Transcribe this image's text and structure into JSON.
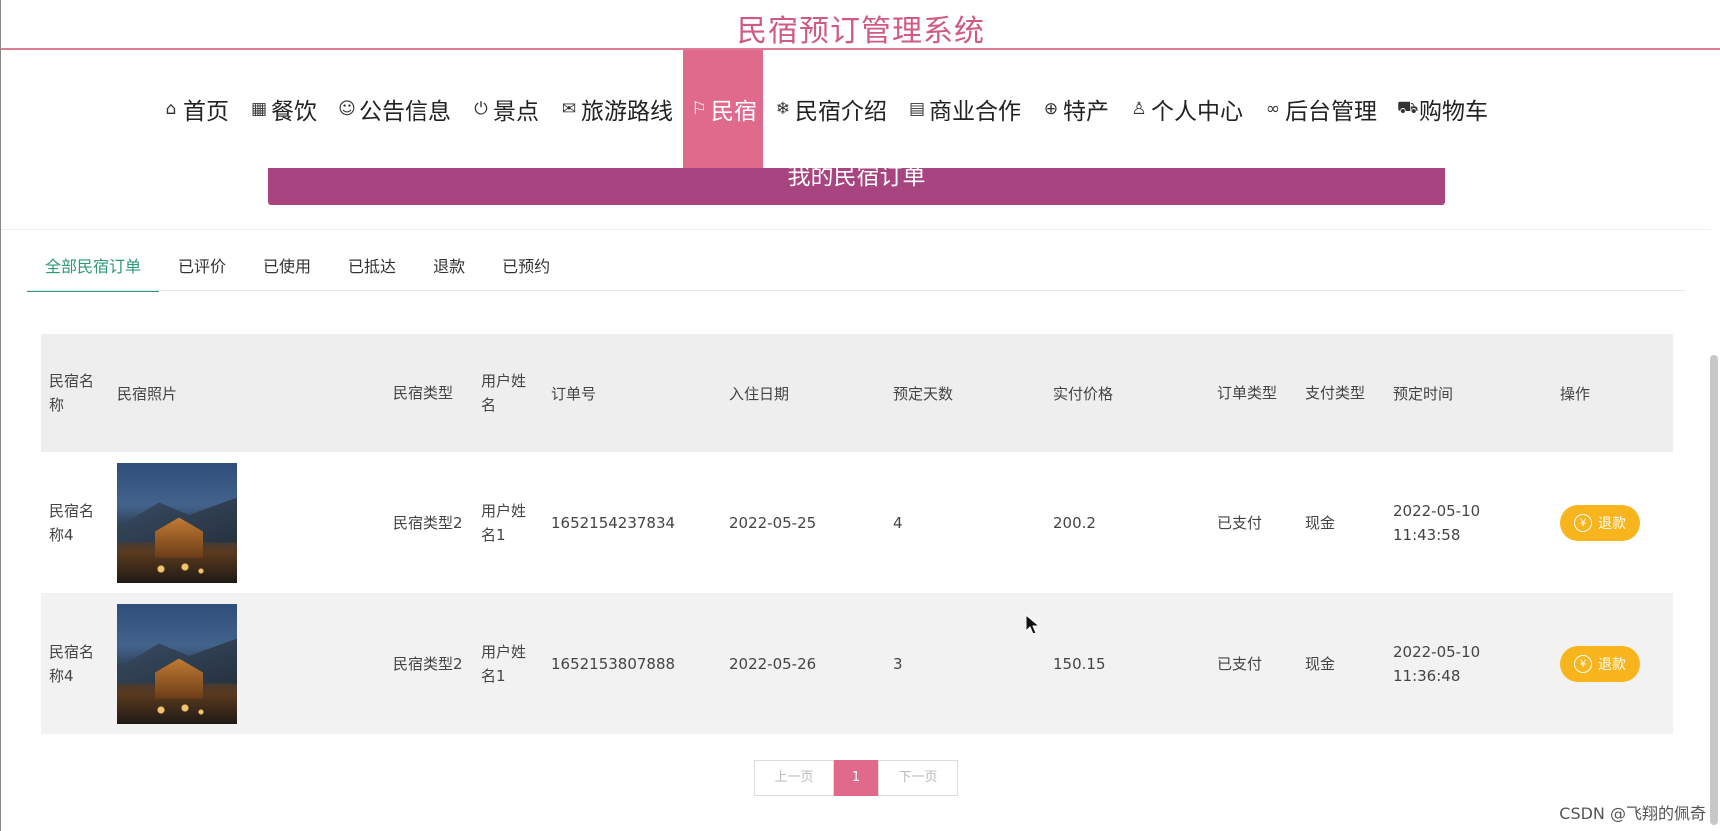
{
  "header": {
    "site_title": "民宿预订管理系统"
  },
  "nav": {
    "items": [
      {
        "icon": "home-icon",
        "glyph": "⌂",
        "label": "首页"
      },
      {
        "icon": "grid-icon",
        "glyph": "▦",
        "label": "餐饮"
      },
      {
        "icon": "smile-icon",
        "glyph": "☺",
        "label": "公告信息"
      },
      {
        "icon": "power-icon",
        "glyph": "⏻",
        "label": "景点"
      },
      {
        "icon": "mail-icon",
        "glyph": "✉",
        "label": "旅游路线"
      },
      {
        "icon": "flag-icon",
        "glyph": "⚐",
        "label": "民宿",
        "active": true
      },
      {
        "icon": "snowflake-icon",
        "glyph": "❄",
        "label": "民宿介绍"
      },
      {
        "icon": "calendar-icon",
        "glyph": "▤",
        "label": "商业合作"
      },
      {
        "icon": "globe-icon",
        "glyph": "⊕",
        "label": "特产"
      },
      {
        "icon": "user-icon",
        "glyph": "♙",
        "label": "个人中心"
      },
      {
        "icon": "link-icon",
        "glyph": "∞",
        "label": "后台管理"
      },
      {
        "icon": "cart-icon",
        "glyph": "⛟",
        "label": "购物车"
      }
    ]
  },
  "banner": {
    "title": "我的民宿订单"
  },
  "tabs": [
    {
      "label": "全部民宿订单",
      "active": true
    },
    {
      "label": "已评价"
    },
    {
      "label": "已使用"
    },
    {
      "label": "已抵达"
    },
    {
      "label": "退款"
    },
    {
      "label": "已预约"
    }
  ],
  "table": {
    "headers": [
      "民宿名称",
      "民宿照片",
      "民宿类型",
      "用户姓名",
      "订单号",
      "入住日期",
      "预定天数",
      "实付价格",
      "订单类型",
      "支付类型",
      "预定时间",
      "操作"
    ],
    "rows": [
      {
        "name": "民宿名称4",
        "type": "民宿类型2",
        "user": "用户姓名1",
        "order_no": "1652154237834",
        "checkin": "2022-05-25",
        "days": "4",
        "price": "200.2",
        "order_type": "已支付",
        "pay_type": "现金",
        "booked_date": "2022-05-10",
        "booked_time": "11:43:58",
        "action": "退款"
      },
      {
        "name": "民宿名称4",
        "type": "民宿类型2",
        "user": "用户姓名1",
        "order_no": "1652153807888",
        "checkin": "2022-05-26",
        "days": "3",
        "price": "150.15",
        "order_type": "已支付",
        "pay_type": "现金",
        "booked_date": "2022-05-10",
        "booked_time": "11:36:48",
        "action": "退款"
      }
    ]
  },
  "pagination": {
    "prev": "上一页",
    "current": "1",
    "next": "下一页"
  },
  "watermark": "CSDN @飞翔的佩奇",
  "colors": {
    "accent": "#e06a8b",
    "banner": "#a8447f",
    "tab_active": "#2c9a74",
    "refund": "#f8b41d"
  }
}
